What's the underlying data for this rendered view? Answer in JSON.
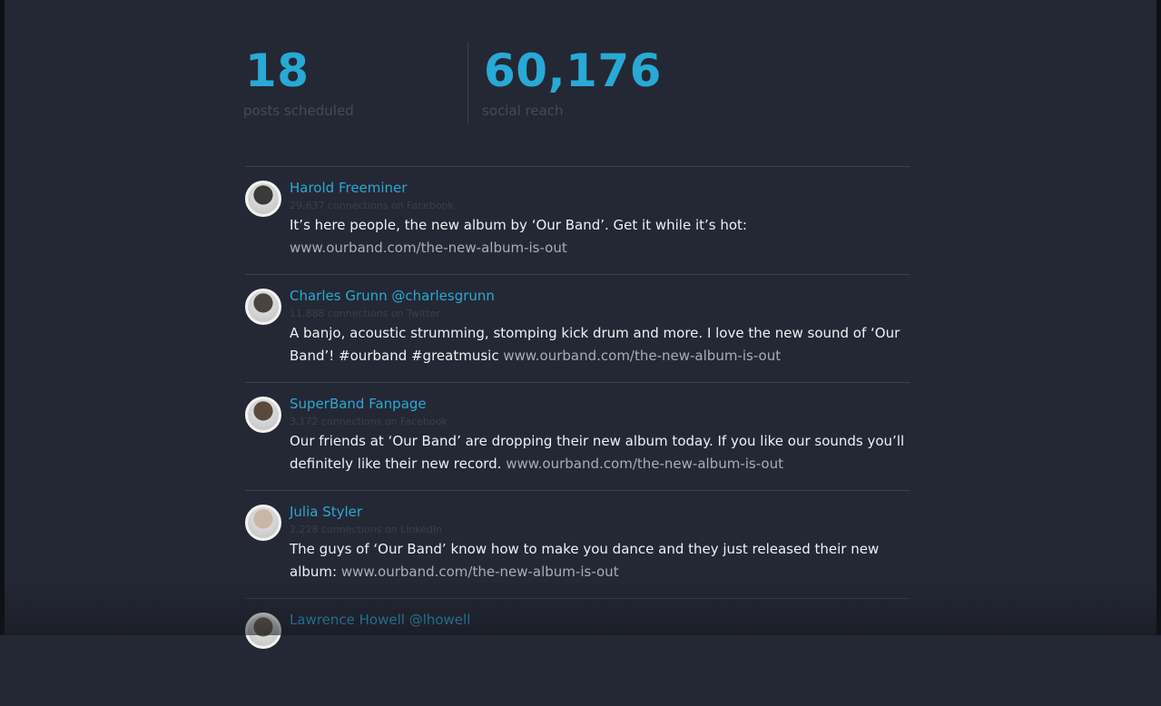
{
  "stats": [
    {
      "value": "18",
      "label": "posts scheduled"
    },
    {
      "value": "60,176",
      "label": "social reach"
    }
  ],
  "posts": [
    {
      "author": "Harold Freeminer",
      "meta": "29,637 connections on Facebook",
      "text": "It’s here people, the new album by ‘Our Band’. Get it while it’s hot:  ",
      "link": "www.ourband.com/the-new-album-is-out",
      "avatar_icon": "avatar-photo-icon",
      "avatar_color": "#3a3a3a"
    },
    {
      "author": "Charles Grunn @charlesgrunn",
      "meta": "11,888 connections on Twitter",
      "text": "A banjo, acoustic strumming, stomping kick drum and more. I love the new sound of ‘Our Band’! #ourband #greatmusic ",
      "link": "www.ourband.com/the-new-album-is-out",
      "avatar_icon": "avatar-photo-icon",
      "avatar_color": "#4a4440"
    },
    {
      "author": "SuperBand Fanpage",
      "meta": "3,172 connections on Facebook",
      "text": "Our friends at ‘Our Band’ are dropping their new album today. If you like our sounds you’ll definitely like their new record. ",
      "link": "www.ourband.com/the-new-album-is-out",
      "avatar_icon": "avatar-photo-icon",
      "avatar_color": "#5a4a3e"
    },
    {
      "author": "Julia Styler",
      "meta": "2,228 connections on LinkedIn",
      "text": "The guys of  ‘Our Band’ know how to make you dance and they just released their new album:  ",
      "link": "www.ourband.com/the-new-album-is-out",
      "avatar_icon": "avatar-photo-icon",
      "avatar_color": "#c9b6a4"
    },
    {
      "author": "Lawrence Howell @lhowell",
      "meta": "",
      "text": "",
      "link": "",
      "avatar_icon": "avatar-photo-icon",
      "avatar_color": "#6a5e54"
    }
  ],
  "colors": {
    "background": "#242834",
    "accent": "#29a9d6",
    "link": "#a9adb6"
  }
}
